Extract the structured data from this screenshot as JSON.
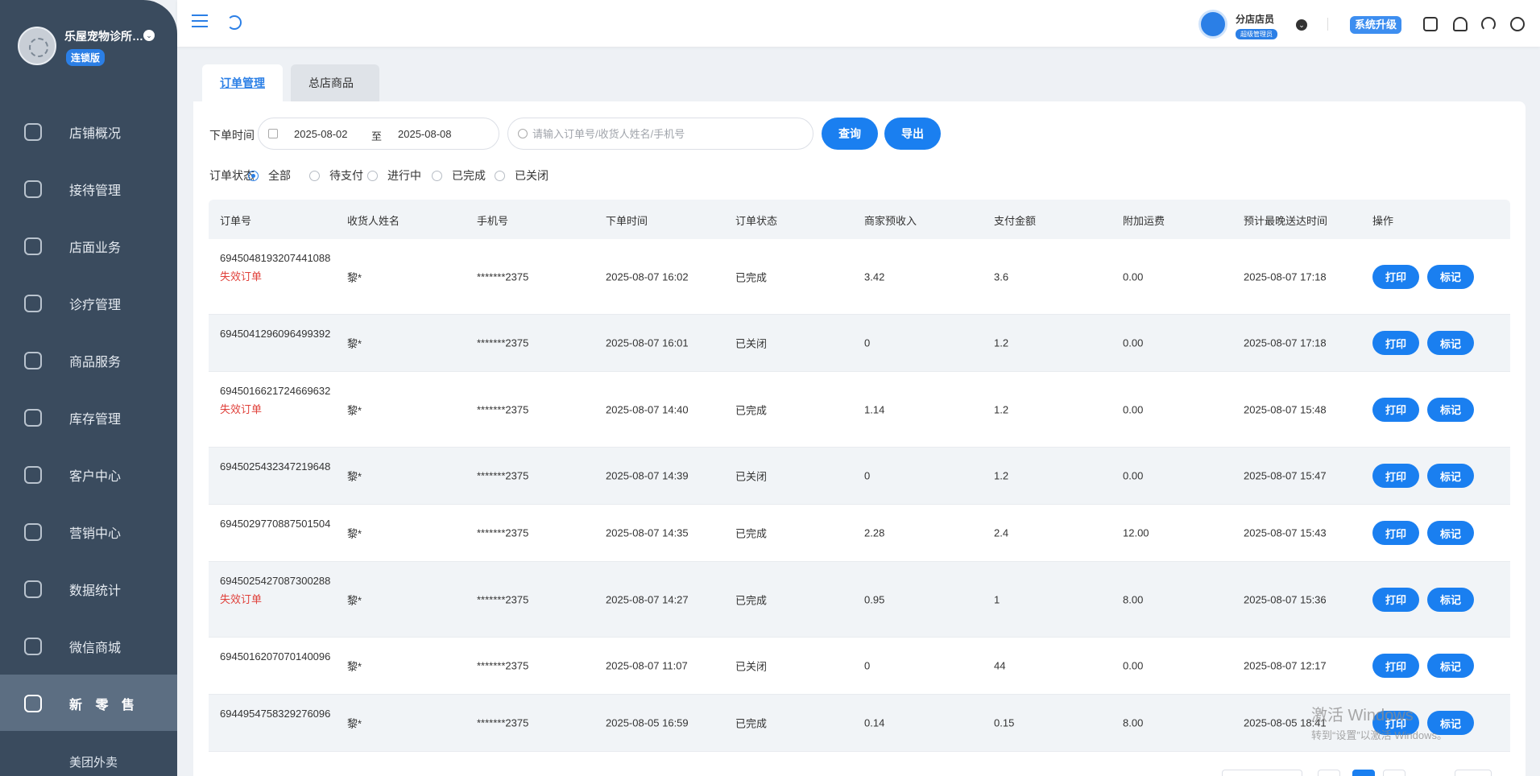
{
  "sidebar": {
    "store_name": "乐屋宠物诊所…",
    "edition": "连锁版",
    "items": [
      {
        "label": "店铺概况",
        "icon": "dashboard-icon"
      },
      {
        "label": "接待管理",
        "icon": "reception-icon"
      },
      {
        "label": "店面业务",
        "icon": "store-icon"
      },
      {
        "label": "诊疗管理",
        "icon": "medical-kit-icon"
      },
      {
        "label": "商品服务",
        "icon": "goods-bag-icon"
      },
      {
        "label": "库存管理",
        "icon": "inventory-box-icon"
      },
      {
        "label": "客户中心",
        "icon": "customer-icon"
      },
      {
        "label": "营销中心",
        "icon": "marketing-icon"
      },
      {
        "label": "数据统计",
        "icon": "statistics-icon"
      },
      {
        "label": "微信商城",
        "icon": "wechat-icon"
      },
      {
        "label": "新 零 售",
        "icon": "new-retail-cube-icon",
        "active": true
      }
    ],
    "submenu": "美团外卖"
  },
  "header": {
    "user_name": "分店店员",
    "user_role": "超级管理员",
    "upgrade_label": "系统升级"
  },
  "tabs": [
    {
      "label": "订单管理",
      "active": true
    },
    {
      "label": "总店商品",
      "active": false
    }
  ],
  "filters": {
    "time_label": "下单时间",
    "date_start": "2025-08-02",
    "date_to": "至",
    "date_end": "2025-08-08",
    "search_placeholder": "请输入订单号/收货人姓名/手机号",
    "query_label": "查询",
    "export_label": "导出",
    "status_label": "订单状态",
    "status_options": [
      "全部",
      "待支付",
      "进行中",
      "已完成",
      "已关闭"
    ],
    "status_selected": "全部"
  },
  "table": {
    "columns": [
      "订单号",
      "收货人姓名",
      "手机号",
      "下单时间",
      "订单状态",
      "商家预收入",
      "支付金额",
      "附加运费",
      "预计最晚送达时间",
      "操作"
    ],
    "print_label": "打印",
    "mark_label": "标记",
    "fail_label": "失效订单",
    "rows": [
      {
        "order": "6945048193207441088",
        "failed": true,
        "name": "黎*",
        "phone": "*******2375",
        "time": "2025-08-07 16:02",
        "status": "已完成",
        "income": "3.42",
        "paid": "3.6",
        "freight": "0.00",
        "eta": "2025-08-07 17:18"
      },
      {
        "order": "6945041296096499392",
        "failed": false,
        "name": "黎*",
        "phone": "*******2375",
        "time": "2025-08-07 16:01",
        "status": "已关闭",
        "income": "0",
        "paid": "1.2",
        "freight": "0.00",
        "eta": "2025-08-07 17:18"
      },
      {
        "order": "6945016621724669632",
        "failed": true,
        "name": "黎*",
        "phone": "*******2375",
        "time": "2025-08-07 14:40",
        "status": "已完成",
        "income": "1.14",
        "paid": "1.2",
        "freight": "0.00",
        "eta": "2025-08-07 15:48"
      },
      {
        "order": "6945025432347219648",
        "failed": false,
        "name": "黎*",
        "phone": "*******2375",
        "time": "2025-08-07 14:39",
        "status": "已关闭",
        "income": "0",
        "paid": "1.2",
        "freight": "0.00",
        "eta": "2025-08-07 15:47"
      },
      {
        "order": "6945029770887501504",
        "failed": false,
        "name": "黎*",
        "phone": "*******2375",
        "time": "2025-08-07 14:35",
        "status": "已完成",
        "income": "2.28",
        "paid": "2.4",
        "freight": "12.00",
        "eta": "2025-08-07 15:43"
      },
      {
        "order": "6945025427087300288",
        "failed": true,
        "name": "黎*",
        "phone": "*******2375",
        "time": "2025-08-07 14:27",
        "status": "已完成",
        "income": "0.95",
        "paid": "1",
        "freight": "8.00",
        "eta": "2025-08-07 15:36"
      },
      {
        "order": "6945016207070140096",
        "failed": false,
        "name": "黎*",
        "phone": "*******2375",
        "time": "2025-08-07 11:07",
        "status": "已关闭",
        "income": "0",
        "paid": "44",
        "freight": "0.00",
        "eta": "2025-08-07 12:17"
      },
      {
        "order": "6944954758329276096",
        "failed": false,
        "name": "黎*",
        "phone": "*******2375",
        "time": "2025-08-05 16:59",
        "status": "已完成",
        "income": "0.14",
        "paid": "0.15",
        "freight": "8.00",
        "eta": "2025-08-05 18:41"
      }
    ]
  },
  "watermark": {
    "line1": "激活 Windows",
    "line2": "转到“设置”以激活 Windows。"
  }
}
